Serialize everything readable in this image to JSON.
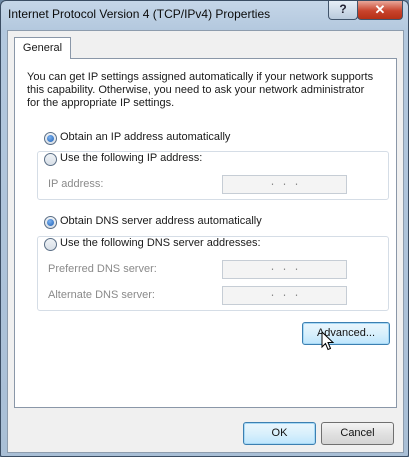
{
  "window": {
    "title": "Internet Protocol Version 4 (TCP/IPv4) Properties",
    "help_glyph": "?",
    "close_glyph": "✕"
  },
  "tabs": [
    {
      "label": "General",
      "selected": true
    }
  ],
  "info_text": "You can get IP settings assigned automatically if your network supports this capability. Otherwise, you need to ask your network administrator for the appropriate IP settings.",
  "ip_section": {
    "auto_label": "Obtain an IP address automatically",
    "auto_checked": true,
    "manual_label": "Use the following IP address:",
    "manual_checked": false,
    "fields": [
      {
        "label": "IP address:",
        "value": ".       .       ."
      }
    ]
  },
  "dns_section": {
    "auto_label": "Obtain DNS server address automatically",
    "auto_checked": true,
    "manual_label": "Use the following DNS server addresses:",
    "manual_checked": false,
    "fields": [
      {
        "label": "Preferred DNS server:",
        "value": ".       .       ."
      },
      {
        "label": "Alternate DNS server:",
        "value": ".       .       ."
      }
    ]
  },
  "buttons": {
    "advanced": "Advanced...",
    "ok": "OK",
    "cancel": "Cancel"
  },
  "colors": {
    "title_bar": "#b3c8de",
    "close_button": "#c8432c",
    "focused_button": "#bee6fd"
  }
}
